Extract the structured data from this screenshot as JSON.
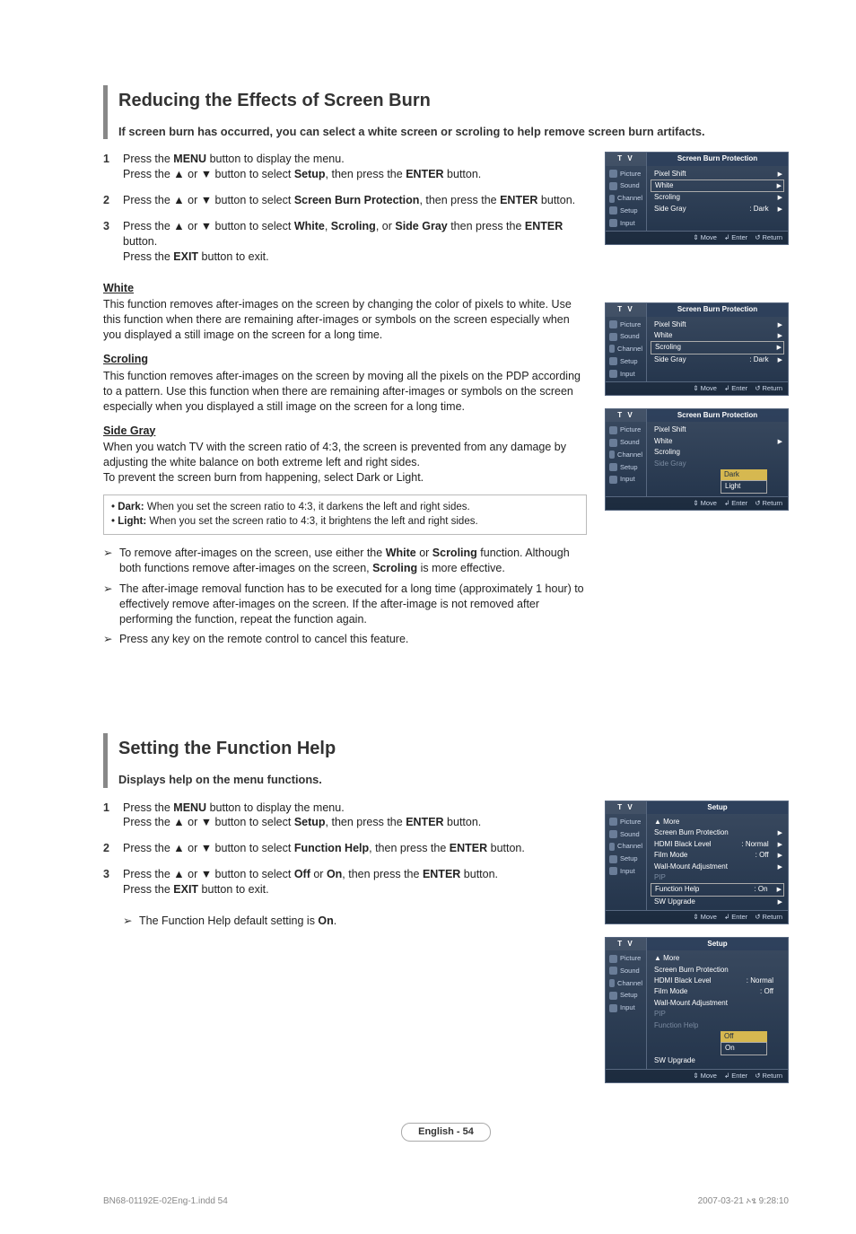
{
  "section1": {
    "title": "Reducing the Effects of Screen Burn",
    "intro": "If screen burn has occurred, you can select a white screen or scroling to help remove screen burn artifacts.",
    "steps": [
      {
        "num": "1",
        "lines": [
          "Press the <b>MENU</b> button to display the menu.",
          "Press the ▲ or ▼ button to select <b>Setup</b>, then press the <b>ENTER</b> button."
        ]
      },
      {
        "num": "2",
        "lines": [
          "Press the ▲ or ▼ button to select <b>Screen Burn Protection</b>, then press the <b>ENTER</b> button."
        ]
      },
      {
        "num": "3",
        "lines": [
          "Press the ▲ or ▼ button to select <b>White</b>, <b>Scroling</b>, or <b>Side Gray</b> then press the <b>ENTER</b> button.",
          "Press the <b>EXIT</b> button to exit."
        ]
      }
    ],
    "white_h": "White",
    "white_p": "This function removes after-images on the screen by changing the color of pixels to white. Use this function when there are remaining after-images or symbols on the screen especially when you displayed a still image on the screen for a long time.",
    "scrol_h": "Scroling",
    "scrol_p": "This function removes after-images on the screen by moving all the pixels on the PDP according to a pattern. Use this function when there are remaining after-images or symbols on the screen especially when you displayed a still image on the screen for a long time.",
    "side_h": "Side Gray",
    "side_p": "When you watch TV with the screen ratio of 4:3, the screen is prevented from any damage by adjusting the white balance on both extreme left and right sides.\nTo prevent the screen burn from happening, select Dark or Light.",
    "note_dark": "• <b>Dark:</b> When you set the screen ratio to 4:3, it darkens the left and right sides.",
    "note_light": "• <b>Light:</b> When you set the screen ratio to 4:3, it brightens the left and right sides.",
    "tips": [
      "To remove after-images on the screen, use either the <b>White</b> or <b>Scroling</b> function. Although both functions remove after-images on the screen, <b>Scroling</b> is more effective.",
      "The after-image removal function has to be executed for a long time (approximately 1 hour) to effectively remove after-images on the screen. If the after-image is not removed after performing the function, repeat the function again.",
      "Press any key on the remote control to cancel this feature."
    ]
  },
  "osd_common": {
    "tv": "T V",
    "side": [
      "Picture",
      "Sound",
      "Channel",
      "Setup",
      "Input"
    ],
    "foot": {
      "move": "Move",
      "enter": "Enter",
      "return": "Return"
    }
  },
  "osd1": {
    "title": "Screen Burn Protection",
    "rows": [
      {
        "label": "Pixel Shift",
        "arr": true
      },
      {
        "label": "White",
        "arr": true,
        "boxed": true
      },
      {
        "label": "Scroling",
        "arr": true
      },
      {
        "label": "Side Gray",
        "val": ": Dark",
        "arr": true
      }
    ]
  },
  "osd2": {
    "title": "Screen Burn Protection",
    "rows": [
      {
        "label": "Pixel Shift",
        "arr": true
      },
      {
        "label": "White",
        "arr": true
      },
      {
        "label": "Scroling",
        "arr": true,
        "boxed": true
      },
      {
        "label": "Side Gray",
        "val": ": Dark",
        "arr": true
      }
    ]
  },
  "osd3": {
    "title": "Screen Burn Protection",
    "rows": [
      {
        "label": "Pixel Shift"
      },
      {
        "label": "White",
        "arr": true
      },
      {
        "label": "Scroling"
      },
      {
        "label": "Side Gray",
        "dim": true
      }
    ],
    "sub": [
      {
        "label": "Dark",
        "sel": true
      },
      {
        "label": "Light",
        "boxed": true
      }
    ]
  },
  "section2": {
    "title": "Setting the Function Help",
    "intro": "Displays help on the menu functions.",
    "steps": [
      {
        "num": "1",
        "lines": [
          "Press the <b>MENU</b> button to display the menu.",
          "Press the ▲ or ▼ button to select <b>Setup</b>, then press the <b>ENTER</b> button."
        ]
      },
      {
        "num": "2",
        "lines": [
          "Press the ▲ or ▼ button to select <b>Function Help</b>, then press the <b>ENTER</b> button."
        ]
      },
      {
        "num": "3",
        "lines": [
          "Press the ▲ or ▼ button to select <b>Off</b> or <b>On</b>, then press the <b>ENTER</b> button.",
          "Press the <b>EXIT</b> button to exit."
        ]
      }
    ],
    "tip": "The Function Help default setting is <b>On</b>."
  },
  "osd4": {
    "title": "Setup",
    "rows": [
      {
        "label": "▲ More"
      },
      {
        "label": "Screen Burn Protection",
        "arr": true
      },
      {
        "label": "HDMI Black Level",
        "val": ": Normal",
        "arr": true
      },
      {
        "label": "Film Mode",
        "val": ": Off",
        "arr": true
      },
      {
        "label": "Wall-Mount Adjustment",
        "arr": true
      },
      {
        "label": "PIP",
        "dim": true
      },
      {
        "label": "Function Help",
        "val": ": On",
        "arr": true,
        "boxed": true
      },
      {
        "label": "SW Upgrade",
        "arr": true
      }
    ]
  },
  "osd5": {
    "title": "Setup",
    "rows": [
      {
        "label": "▲ More"
      },
      {
        "label": "Screen Burn Protection"
      },
      {
        "label": "HDMI Black Level",
        "val": ": Normal"
      },
      {
        "label": "Film Mode",
        "val": ": Off"
      },
      {
        "label": "Wall-Mount Adjustment"
      },
      {
        "label": "PIP",
        "dim": true
      },
      {
        "label": "Function Help",
        "dim": true
      },
      {
        "label": "SW Upgrade"
      }
    ],
    "sub": [
      {
        "label": "Off",
        "sel": true
      },
      {
        "label": "On",
        "boxed": true
      }
    ]
  },
  "page_label": "English - 54",
  "print": {
    "left": "BN68-01192E-02Eng-1.indd   54",
    "right": "2007-03-21   ኦፄ 9:28:10"
  }
}
